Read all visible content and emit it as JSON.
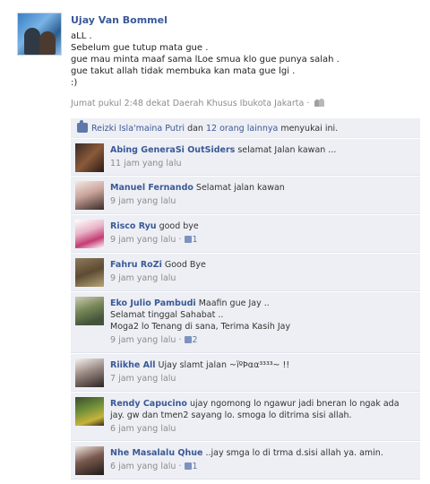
{
  "post": {
    "author": "Ujay Van Bommel",
    "lines": [
      "aLL .",
      "Sebelum gue tutup mata gue .",
      "gue mau minta maaf sama lLoe smua klo gue punya salah .",
      "gue takut allah tidak membuka kan mata gue lgi .",
      ":)"
    ],
    "meta": "Jumat pukul 2:48 dekat Daerah Khusus Ibukota Jakarta · ",
    "privacy_icon": "people-icon"
  },
  "likes": {
    "name": "Reizki Isla'maina Putri",
    "and": " dan ",
    "others": "12 orang lainnya",
    "suffix": " menyukai ini."
  },
  "comments": [
    {
      "name": "Abing GeneraSi OutSiders",
      "lines": [
        " selamat Jalan kawan ..."
      ],
      "time": "11 jam yang lalu",
      "likes": ""
    },
    {
      "name": "Manuel Fernando",
      "lines": [
        " Selamat jalan kawan"
      ],
      "time": "9 jam yang lalu",
      "likes": ""
    },
    {
      "name": "Risco Ryu",
      "lines": [
        " good bye"
      ],
      "time": "9 jam yang lalu · ",
      "likes": "1"
    },
    {
      "name": "Fahru RoZi",
      "lines": [
        " Good Bye"
      ],
      "time": "9 jam yang lalu",
      "likes": ""
    },
    {
      "name": "Eko Julio Pambudi",
      "lines": [
        " Maafin gue Jay ..",
        "Selamat tinggal Sahabat ..",
        "Moga2 lo Tenang di sana, Terima Kasih Jay"
      ],
      "time": "9 jam yang lalu · ",
      "likes": "2"
    },
    {
      "name": "Riikhe All",
      "lines": [
        " Ujay slamt jalan ~ïºÞαα³³³³~ !!"
      ],
      "time": "7 jam yang lalu",
      "likes": ""
    },
    {
      "name": "Rendy Capucino",
      "lines": [
        " ujay ngomong lo ngawur jadi bneran lo ngak ada",
        "jay. gw dan tmen2 sayang lo. smoga lo ditrima sisi allah."
      ],
      "time": "6 jam yang lalu",
      "likes": ""
    },
    {
      "name": "Nhe Masalalu Qhue",
      "lines": [
        " ..jay smga lo di trma d.sisi allah ya. amin."
      ],
      "time": "6 jam yang lalu · ",
      "likes": "1"
    }
  ]
}
